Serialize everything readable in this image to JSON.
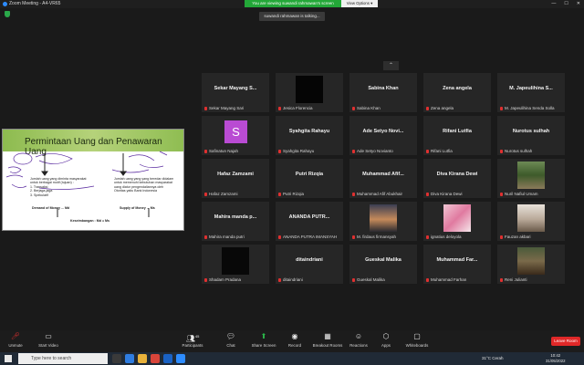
{
  "window": {
    "title": "Zoom Meeting - A4-VR65",
    "min": "—",
    "max": "☐",
    "close": "✕"
  },
  "banner": {
    "message": "You are viewing suwandi rahmawan's screen",
    "options": "View Options ▾"
  },
  "talking": "suwandi rahmawan is talking...",
  "chevron": "⌃",
  "share": {
    "title": "Permintaan Uang dan Penawaran Uang",
    "left_text": [
      "Jumlah uang yang diminta masyarakat",
      "untuk berbagai motif (tujuan) :",
      "1.  Transaksi",
      "2.  Berjaga-jaga",
      "3.  Spekulatif"
    ],
    "right_text": [
      "Jumlah uang yang yang beredar didalam",
      "untuk memenuhi kebutuhan masyarakat",
      "uang diatur pengendaliannya oleh",
      "Otoritas yaitu Bank Indonesia"
    ],
    "demand": "Demand of Money ... Md",
    "supply": "Supply of Money ... Ms",
    "equilibrium": "Keseimbangan : Md = Ms"
  },
  "participants": [
    {
      "name": "Sekar Mayang S...",
      "label": "Sekar Mayang Sari",
      "photo": ""
    },
    {
      "name": "",
      "label": "Jesica Florencia",
      "photo": "black"
    },
    {
      "name": "Sabina Khan",
      "label": "Sabina Khan",
      "photo": ""
    },
    {
      "name": "Zena angela",
      "label": "Zena angela",
      "photo": ""
    },
    {
      "name": "M. Japeulihina S...",
      "label": "M. Japeulihina Senda Solla",
      "photo": ""
    },
    {
      "name": "",
      "label": "Safinatun Najah",
      "photo": "S"
    },
    {
      "name": "Syahgita Rahayu",
      "label": "Syahgita Rahayu",
      "photo": ""
    },
    {
      "name": "Ade Setyo Novi...",
      "label": "Ade Setyo Novianto",
      "photo": ""
    },
    {
      "name": "Rifani Lutfia",
      "label": "Rifani Lutfia",
      "photo": ""
    },
    {
      "name": "Nurotus sulhah",
      "label": "Nurotus sulhah",
      "photo": ""
    },
    {
      "name": "Hafaz Zamzami",
      "label": "Hafaz Zamzami",
      "photo": ""
    },
    {
      "name": "Putri Rizqia",
      "label": "Putri Rizqia",
      "photo": ""
    },
    {
      "name": "Muhammad Afif...",
      "label": "Muhammad Afif Abukhair",
      "photo": ""
    },
    {
      "name": "Diva Kirana Dewi",
      "label": "Diva Kirana Dewi",
      "photo": ""
    },
    {
      "name": "",
      "label": "Nuril Nafiul Umam",
      "photo": "forest"
    },
    {
      "name": "Mahira manda p...",
      "label": "Mahira manda putri",
      "photo": ""
    },
    {
      "name": "ANANDA PUTR...",
      "label": "ANANDA PUTRA IMANSYAH",
      "photo": ""
    },
    {
      "name": "",
      "label": "M. firdaus firmansyah",
      "photo": "sunset"
    },
    {
      "name": "",
      "label": "ignatius deloyola",
      "photo": "pinkflower"
    },
    {
      "name": "",
      "label": "Fauzan akbari",
      "photo": "portrait"
    },
    {
      "name": "",
      "label": "Shadam Pradana",
      "photo": "black"
    },
    {
      "name": "ditaindriani",
      "label": "ditaindriani",
      "photo": ""
    },
    {
      "name": "Gueskal Malika",
      "label": "Gueskal Malika",
      "photo": ""
    },
    {
      "name": "Muhammad Far...",
      "label": "Muhammad Farhan",
      "photo": ""
    },
    {
      "name": "",
      "label": "Reni Julianti",
      "photo": "tree"
    }
  ],
  "toolbar": {
    "unmute": "Unmute",
    "start_video": "Start Video",
    "participants": "Participants",
    "participants_count": "45",
    "chat": "Chat",
    "share_screen": "Share Screen",
    "record": "Record",
    "breakout": "Breakout Rooms",
    "reactions": "Reactions",
    "apps": "Apps",
    "whiteboards": "Whiteboards",
    "leave": "Leave Room"
  },
  "taskbar": {
    "search": "Type here to search",
    "weather": "31°C  Cerah",
    "time": "10:42",
    "date": "31/05/2022"
  },
  "colors": {
    "share_green": "#23a838",
    "leave_red": "#e02828",
    "avatar_purple": "#b94bd3"
  }
}
